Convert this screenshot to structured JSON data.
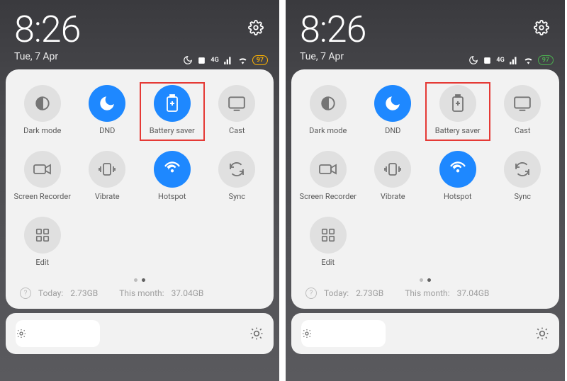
{
  "phones": [
    {
      "clock": "8:26",
      "date": "Tue, 7 Apr",
      "battery_value": "97",
      "battery_variant": "orange",
      "toggles": [
        {
          "id": "dark-mode",
          "label": "Dark mode",
          "icon": "dark-mode",
          "active": false,
          "highlighted": false
        },
        {
          "id": "dnd",
          "label": "DND",
          "icon": "dnd",
          "active": true,
          "highlighted": false
        },
        {
          "id": "battery-saver",
          "label": "Battery saver",
          "icon": "battery-saver",
          "active": true,
          "highlighted": true
        },
        {
          "id": "cast",
          "label": "Cast",
          "icon": "cast",
          "active": false,
          "highlighted": false
        },
        {
          "id": "screen-recorder",
          "label": "Screen Recorder",
          "icon": "recorder",
          "active": false,
          "highlighted": false
        },
        {
          "id": "vibrate",
          "label": "Vibrate",
          "icon": "vibrate",
          "active": false,
          "highlighted": false
        },
        {
          "id": "hotspot",
          "label": "Hotspot",
          "icon": "hotspot",
          "active": true,
          "highlighted": false
        },
        {
          "id": "sync",
          "label": "Sync",
          "icon": "sync",
          "active": false,
          "highlighted": false
        },
        {
          "id": "edit",
          "label": "Edit",
          "icon": "edit",
          "active": false,
          "highlighted": false
        }
      ],
      "data_today_label": "Today:",
      "data_today_value": "2.73GB",
      "data_month_label": "This month:",
      "data_month_value": "37.04GB",
      "brightness_pct": 34
    },
    {
      "clock": "8:26",
      "date": "Tue, 7 Apr",
      "battery_value": "97",
      "battery_variant": "green",
      "toggles": [
        {
          "id": "dark-mode",
          "label": "Dark mode",
          "icon": "dark-mode",
          "active": false,
          "highlighted": false
        },
        {
          "id": "dnd",
          "label": "DND",
          "icon": "dnd",
          "active": true,
          "highlighted": false
        },
        {
          "id": "battery-saver",
          "label": "Battery saver",
          "icon": "battery-saver",
          "active": false,
          "highlighted": true
        },
        {
          "id": "cast",
          "label": "Cast",
          "icon": "cast",
          "active": false,
          "highlighted": false
        },
        {
          "id": "screen-recorder",
          "label": "Screen Recorder",
          "icon": "recorder",
          "active": false,
          "highlighted": false
        },
        {
          "id": "vibrate",
          "label": "Vibrate",
          "icon": "vibrate",
          "active": false,
          "highlighted": false
        },
        {
          "id": "hotspot",
          "label": "Hotspot",
          "icon": "hotspot",
          "active": true,
          "highlighted": false
        },
        {
          "id": "sync",
          "label": "Sync",
          "icon": "sync",
          "active": false,
          "highlighted": false
        },
        {
          "id": "edit",
          "label": "Edit",
          "icon": "edit",
          "active": false,
          "highlighted": false
        }
      ],
      "data_today_label": "Today:",
      "data_today_value": "2.73GB",
      "data_month_label": "This month:",
      "data_month_value": "37.04GB",
      "brightness_pct": 34
    }
  ]
}
